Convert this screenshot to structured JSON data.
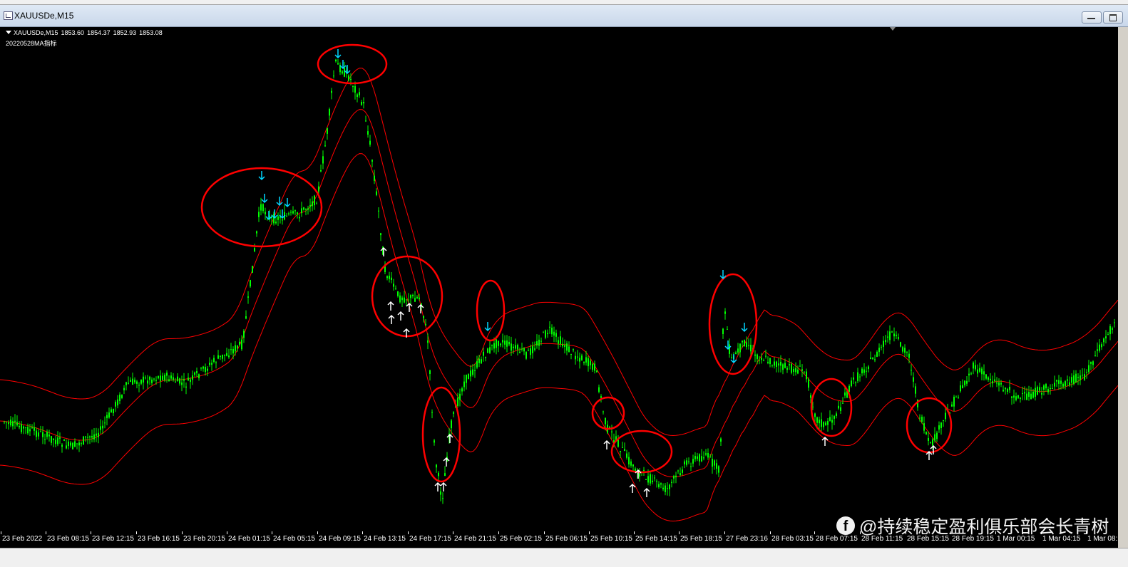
{
  "window": {
    "title": "XAUUSDe,M15",
    "minimize_icon": "minimize-icon",
    "restore_icon": "restore-icon"
  },
  "chart": {
    "symbol": "XAUUSDe,M15",
    "ohlc": [
      "1853.60",
      "1854.37",
      "1852.93",
      "1853.08"
    ],
    "indicator": "20220528MA指标",
    "colors": {
      "background": "#000000",
      "candles": "#00ff00",
      "bands": "#ff0000",
      "sell_arrows": "#00d7ff",
      "buy_arrows": "#ffffff",
      "circles": "#ff0000"
    },
    "time_labels": [
      "23 Feb 2022",
      "23 Feb 08:15",
      "23 Feb 12:15",
      "23 Feb 16:15",
      "23 Feb 20:15",
      "24 Feb 01:15",
      "24 Feb 05:15",
      "24 Feb 09:15",
      "24 Feb 13:15",
      "24 Feb 17:15",
      "24 Feb 21:15",
      "25 Feb 02:15",
      "25 Feb 06:15",
      "25 Feb 10:15",
      "25 Feb 14:15",
      "25 Feb 18:15",
      "27 Feb 23:16",
      "28 Feb 03:15",
      "28 Feb 07:15",
      "28 Feb 11:15",
      "28 Feb 15:15",
      "28 Feb 19:15",
      "1 Mar 00:15",
      "1 Mar 04:15",
      "1 Mar 08:1"
    ]
  },
  "watermark": {
    "icon": "facebook-icon",
    "text": "@持续稳定盈利俱乐部会长青树"
  }
}
